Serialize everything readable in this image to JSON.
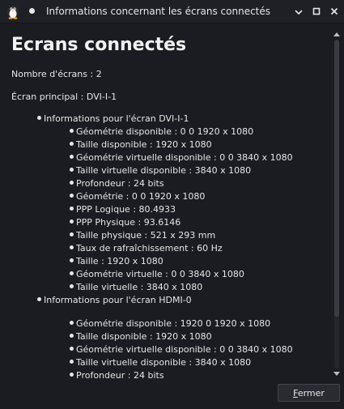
{
  "window": {
    "title": "Informations concernant les écrans connectés",
    "icons": {
      "app": "penguin-app-icon",
      "menu": "window-menu-dot",
      "minimize": "minimize-icon",
      "maximize": "maximize-icon",
      "close": "close-icon"
    }
  },
  "heading": "Ecrans connectés",
  "summary": {
    "screen_count": "Nombre d'écrans : 2",
    "primary_screen": "Écran principal : DVI-I-1"
  },
  "screens": [
    {
      "header": "Informations pour l'écran DVI-I-1",
      "details": [
        "Géométrie disponible : 0 0 1920 x 1080",
        "Taille disponible : 1920 x 1080",
        "Géométrie virtuelle disponible : 0 0 3840 x 1080",
        "Taille virtuelle disponible : 3840 x 1080",
        "Profondeur : 24 bits",
        "Géométrie : 0 0 1920 x 1080",
        "PPP Logique : 80.4933",
        "PPP Physique : 93.6146",
        "Taille physique : 521 x 293 mm",
        "Taux de rafraîchissement : 60 Hz",
        "Taille : 1920 x 1080",
        "Géométrie virtuelle : 0 0 3840 x 1080",
        "Taille virtuelle : 3840 x 1080"
      ]
    },
    {
      "header": "Informations pour l'écran HDMI-0",
      "details": [
        "Géométrie disponible : 1920 0 1920 x 1080",
        "Taille disponible : 1920 x 1080",
        "Géométrie virtuelle disponible : 0 0 3840 x 1080",
        "Taille virtuelle disponible : 3840 x 1080",
        "Profondeur : 24 bits"
      ]
    }
  ],
  "footer": {
    "close_mnemonic": "F",
    "close_rest": "ermer"
  },
  "scroll": {
    "up_icon": "scroll-up-arrow-icon",
    "down_icon": "scroll-down-arrow-icon"
  }
}
